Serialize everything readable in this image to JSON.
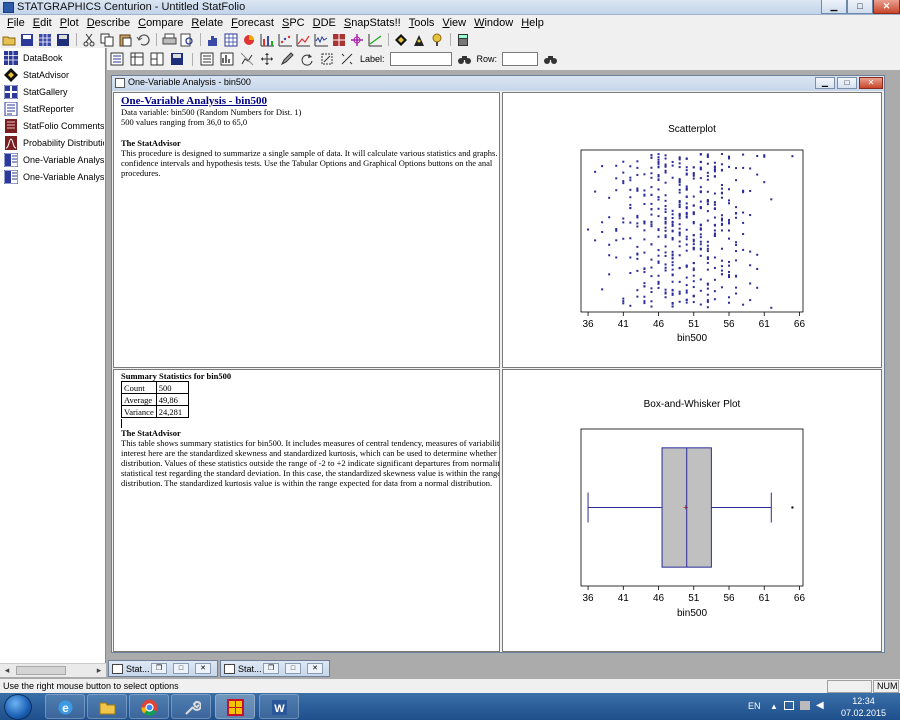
{
  "app": {
    "title": "STATGRAPHICS Centurion - Untitled StatFolio",
    "controls": {
      "minimize": "▁",
      "maximize": "□",
      "close": "✕"
    }
  },
  "menu": [
    "File",
    "Edit",
    "Plot",
    "Describe",
    "Compare",
    "Relate",
    "Forecast",
    "SPC",
    "DDE",
    "SnapStats!!",
    "Tools",
    "View",
    "Window",
    "Help"
  ],
  "toolbar2": {
    "label_text": "Label:",
    "row_text": "Row:"
  },
  "sidebar": {
    "items": [
      {
        "label": "DataBook",
        "icon": "databook-icon",
        "color": "#2b3a9a"
      },
      {
        "label": "StatAdvisor",
        "icon": "statadvisor-icon",
        "color": "#222222"
      },
      {
        "label": "StatGallery",
        "icon": "statgallery-icon",
        "color": "#2b3a9a"
      },
      {
        "label": "StatReporter",
        "icon": "statreporter-icon",
        "color": "#2b3a9a"
      },
      {
        "label": "StatFolio Comments",
        "icon": "comments-icon",
        "color": "#7a1f1f"
      },
      {
        "label": "Probability Distributions",
        "icon": "distributions-icon",
        "color": "#7a1f1f"
      },
      {
        "label": "One-Variable Analysis - b",
        "icon": "analysis-icon",
        "color": "#2b3a9a"
      },
      {
        "label": "One-Variable Analysis - b",
        "icon": "analysis-icon",
        "color": "#2b3a9a"
      }
    ]
  },
  "child_window": {
    "title": "One-Variable Analysis - bin500"
  },
  "pane_top_left": {
    "heading": "One-Variable Analysis - bin500",
    "lines": [
      "Data variable: bin500 (Random Numbers for Dist. 1)",
      "500 values ranging from 36,0 to 65,0"
    ],
    "advisor_heading": "The StatAdvisor",
    "advisor_lines": [
      "This procedure is designed to summarize a single sample of data.  It will calculate various statistics and graphs.",
      "confidence intervals and hypothesis tests.  Use the Tabular Options and Graphical Options buttons on the anal",
      "procedures."
    ]
  },
  "pane_bottom_left": {
    "heading": "Summary Statistics for bin500",
    "table": [
      [
        "Count",
        "500"
      ],
      [
        "Average",
        "49,86"
      ],
      [
        "Variance",
        "24,281"
      ]
    ],
    "advisor_heading": "The StatAdvisor",
    "advisor_lines": [
      "This table shows summary statistics for bin500.  It includes measures of central tendency, measures of variabilit",
      "interest here are the standardized skewness and standardized kurtosis, which can be used to determine whether t",
      "distribution.  Values of these statistics outside the range of -2 to +2 indicate significant departures from normalit",
      "statistical test regarding the standard deviation.  In this case, the standardized skewness value is within the range",
      "distribution.  The standardized kurtosis value is within the range expected for data from a normal distribution."
    ]
  },
  "chart_data": [
    {
      "type": "scatter",
      "title": "Scatterplot",
      "xlabel": "bin500",
      "xlim": [
        35,
        66.5
      ],
      "xticks": [
        "36",
        "41",
        "46",
        "51",
        "56",
        "61",
        "66"
      ],
      "point_color": "#2b2b9a",
      "x_values_observed": [
        36,
        37,
        38,
        39,
        40,
        41,
        42,
        43,
        44,
        45,
        46,
        47,
        48,
        49,
        50,
        51,
        52,
        53,
        54,
        55,
        56,
        57,
        58,
        59,
        60,
        61,
        62,
        65
      ],
      "approx_counts_per_value": [
        1,
        3,
        4,
        5,
        7,
        10,
        13,
        17,
        21,
        25,
        29,
        31,
        33,
        34,
        34,
        33,
        31,
        29,
        25,
        22,
        18,
        14,
        10,
        7,
        5,
        3,
        2,
        1
      ]
    },
    {
      "type": "box",
      "title": "Box-and-Whisker Plot",
      "xlabel": "bin500",
      "xlim": [
        35,
        66.5
      ],
      "xticks": [
        "36",
        "41",
        "46",
        "51",
        "56",
        "61",
        "66"
      ],
      "whisker_low": 36,
      "q1": 46.5,
      "median": 50,
      "q3": 53.5,
      "whisker_high": 62,
      "mean": 49.86,
      "outliers": [
        65
      ],
      "box_fill": "#c0c0c0",
      "line_color": "#2b2b9a"
    }
  ],
  "mdi_tabs": [
    {
      "label": "Stat..."
    },
    {
      "label": "Stat..."
    }
  ],
  "status": {
    "message": "Use the right mouse button to select options",
    "num": "NUM"
  },
  "tray": {
    "lang": "EN",
    "time": "12:34",
    "date": "07.02.2015"
  }
}
